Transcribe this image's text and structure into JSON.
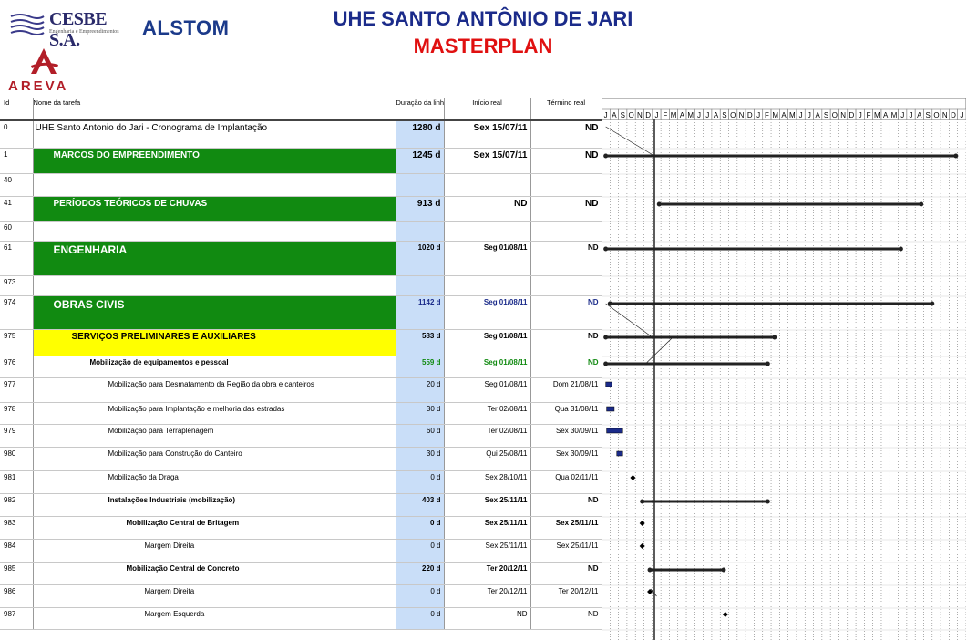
{
  "header": {
    "title": "UHE SANTO ANTÔNIO DE JARI",
    "subtitle": "MASTERPLAN",
    "logos": {
      "cesbe": "CESBE S.A.",
      "cesbe_tagline": "Engenharia e Empreendimentos",
      "alstom": "ALSTOM",
      "areva": "AREVA"
    }
  },
  "columns": {
    "id": "Id",
    "name": "Nome da tarefa",
    "duration": "Duração da linha de",
    "start": "Início real",
    "end": "Término real"
  },
  "timeline_months": [
    "J",
    "A",
    "S",
    "O",
    "N",
    "D",
    "J",
    "F",
    "M",
    "A",
    "M",
    "J",
    "J",
    "A",
    "S",
    "O",
    "N",
    "D",
    "J",
    "F",
    "M",
    "A",
    "M",
    "J",
    "J",
    "A",
    "S",
    "O",
    "N",
    "D",
    "J",
    "F",
    "M",
    "A",
    "M",
    "J",
    "J",
    "A",
    "S",
    "O",
    "N",
    "D",
    "J"
  ],
  "rows": [
    {
      "id": "0",
      "name": "UHE Santo Antonio do Jari - Cronograma de Implantação",
      "duration": "1280 d",
      "start": "Sex 15/07/11",
      "end": "ND"
    },
    {
      "id": "1",
      "name": "MARCOS DO EMPREENDIMENTO",
      "duration": "1245 d",
      "start": "Sex 15/07/11",
      "end": "ND"
    },
    {
      "id": "40",
      "name": "",
      "duration": "",
      "start": "",
      "end": ""
    },
    {
      "id": "41",
      "name": "PERÍODOS TEÓRICOS DE CHUVAS",
      "duration": "913 d",
      "start": "ND",
      "end": "ND"
    },
    {
      "id": "60",
      "name": "",
      "duration": "",
      "start": "",
      "end": ""
    },
    {
      "id": "61",
      "name": "ENGENHARIA",
      "duration": "1020 d",
      "start": "Seg 01/08/11",
      "end": "ND"
    },
    {
      "id": "973",
      "name": "",
      "duration": "",
      "start": "",
      "end": ""
    },
    {
      "id": "974",
      "name": "OBRAS CIVIS",
      "duration": "1142 d",
      "start": "Seg 01/08/11",
      "end": "ND"
    },
    {
      "id": "975",
      "name": "SERVIÇOS PRELIMINARES E AUXILIARES",
      "duration": "583 d",
      "start": "Seg 01/08/11",
      "end": "ND"
    },
    {
      "id": "976",
      "name": "Mobilização de equipamentos e pessoal",
      "duration": "559 d",
      "start": "Seg 01/08/11",
      "end": "ND"
    },
    {
      "id": "977",
      "name": "Mobilização para Desmatamento da Região da obra e canteiros",
      "duration": "20 d",
      "start": "Seg 01/08/11",
      "end": "Dom 21/08/11"
    },
    {
      "id": "978",
      "name": "Mobilização para Implantação e melhoria das estradas",
      "duration": "30 d",
      "start": "Ter 02/08/11",
      "end": "Qua 31/08/11"
    },
    {
      "id": "979",
      "name": "Mobilização para Terraplenagem",
      "duration": "60 d",
      "start": "Ter 02/08/11",
      "end": "Sex 30/09/11"
    },
    {
      "id": "980",
      "name": "Mobilização para Construção do Canteiro",
      "duration": "30 d",
      "start": "Qui 25/08/11",
      "end": "Sex 30/09/11"
    },
    {
      "id": "981",
      "name": "Mobilização da Draga",
      "duration": "0 d",
      "start": "Sex 28/10/11",
      "end": "Qua 02/11/11"
    },
    {
      "id": "982",
      "name": "Instalações Industriais (mobilização)",
      "duration": "403 d",
      "start": "Sex 25/11/11",
      "end": "ND"
    },
    {
      "id": "983",
      "name": "Mobilização Central de Britagem",
      "duration": "0 d",
      "start": "Sex 25/11/11",
      "end": "Sex 25/11/11"
    },
    {
      "id": "984",
      "name": "Margem Direita",
      "duration": "0 d",
      "start": "Sex 25/11/11",
      "end": "Sex 25/11/11"
    },
    {
      "id": "985",
      "name": "Mobilização Central de Concreto",
      "duration": "220 d",
      "start": "Ter 20/12/11",
      "end": "ND"
    },
    {
      "id": "986",
      "name": "Margem Direita",
      "duration": "0 d",
      "start": "Ter 20/12/11",
      "end": "Ter 20/12/11"
    },
    {
      "id": "987",
      "name": "Margem Esquerda",
      "duration": "0 d",
      "start": "ND",
      "end": "ND"
    }
  ],
  "colors": {
    "green": "#118a11",
    "yellow": "#ffff00",
    "duration_bg": "#c9def8",
    "navy": "#1b2b8a",
    "red": "#e01010"
  }
}
